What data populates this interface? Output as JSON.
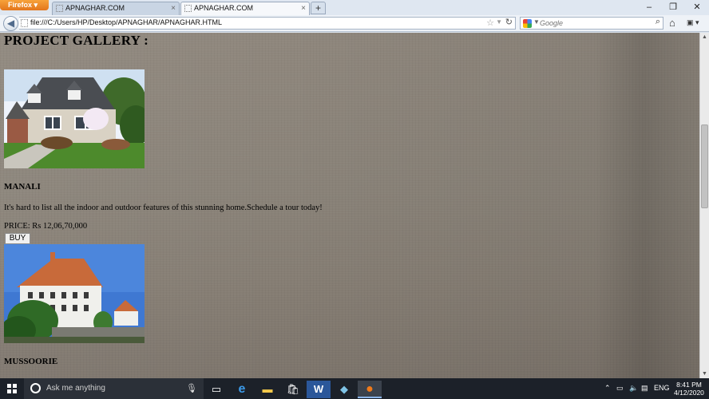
{
  "browser": {
    "app_button_label": "Firefox",
    "tabs": [
      {
        "title": "APNAGHAR.COM",
        "close": "×"
      },
      {
        "title": "APNAGHAR.COM",
        "close": "×"
      }
    ],
    "new_tab": "+",
    "window_controls": {
      "minimize": "–",
      "restore": "❐",
      "close": "✕"
    },
    "back": "◀",
    "url": "file:///C:/Users/HP/Desktop/APNAGHAR/APNAGHAR.HTML",
    "bookmark_star": "☆",
    "url_dropdown": "▼",
    "reload": "↻",
    "search_engine_dropdown": "▼",
    "search_placeholder": "Google",
    "search_icon": "⌕",
    "home": "⌂",
    "addon": "▣ ▾"
  },
  "page": {
    "gallery_title": "PROJECT GALLERY :",
    "properties": [
      {
        "name": "MANALI",
        "description": "It's hard to list all the indoor and outdoor features of this stunning home.Schedule a tour today!",
        "price": "PRICE: Rs 12,06,70,000",
        "buy_label": "BUY"
      },
      {
        "name": "MUSSOORIE"
      }
    ]
  },
  "scrollbar": {
    "up": "▲",
    "down": "▼"
  },
  "taskbar": {
    "search_text": "Ask me anything",
    "mic": "🎙",
    "icons": {
      "task_view": "▭",
      "edge": "e",
      "explorer": "▬",
      "store": "🛍",
      "word": "W",
      "app": "◆",
      "firefox": "●"
    },
    "tray": {
      "chevron": "⌃",
      "battery": "▭",
      "volume": "🔈",
      "notifications": "▤",
      "language": "ENG"
    },
    "time": "8:41 PM",
    "date": "4/12/2020"
  }
}
